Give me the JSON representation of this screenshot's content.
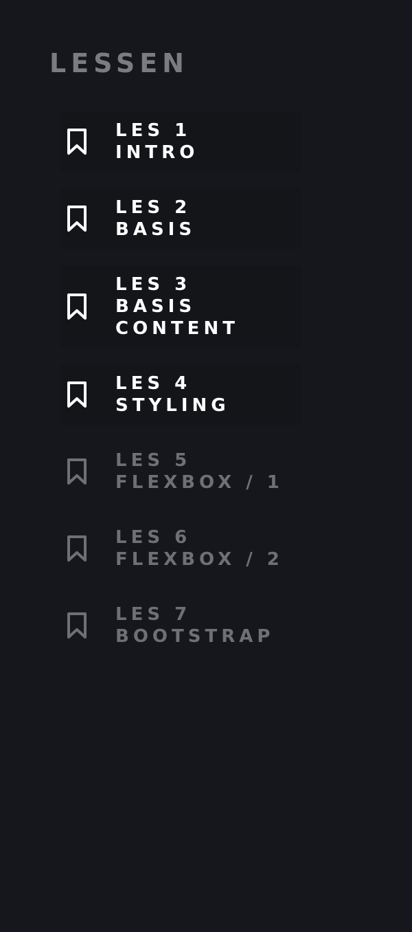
{
  "sidebar": {
    "heading": "LESSEN",
    "items": [
      {
        "number": "LES 1",
        "title": "INTRO",
        "title_line2": "",
        "icon": "bookmark-icon",
        "active": true
      },
      {
        "number": "LES 2",
        "title": "BASIS",
        "title_line2": "",
        "icon": "bookmark-icon",
        "active": true
      },
      {
        "number": "LES 3",
        "title": "BASIS",
        "title_line2": "CONTENT",
        "icon": "bookmark-icon",
        "active": true
      },
      {
        "number": "LES 4",
        "title": "STYLING",
        "title_line2": "",
        "icon": "bookmark-icon",
        "active": true
      },
      {
        "number": "LES 5",
        "title": "FLEXBOX / 1",
        "title_line2": "",
        "icon": "bookmark-icon",
        "active": false
      },
      {
        "number": "LES 6",
        "title": "FLEXBOX / 2",
        "title_line2": "",
        "icon": "bookmark-icon",
        "active": false
      },
      {
        "number": "LES 7",
        "title": "BOOTSTRAP",
        "title_line2": "",
        "icon": "bookmark-icon",
        "active": false
      }
    ]
  },
  "colors": {
    "background": "#16171c",
    "item_background": "#141519",
    "active_text": "#ffffff",
    "inactive_text": "#6f6f74",
    "heading_text": "#7c7c80"
  }
}
